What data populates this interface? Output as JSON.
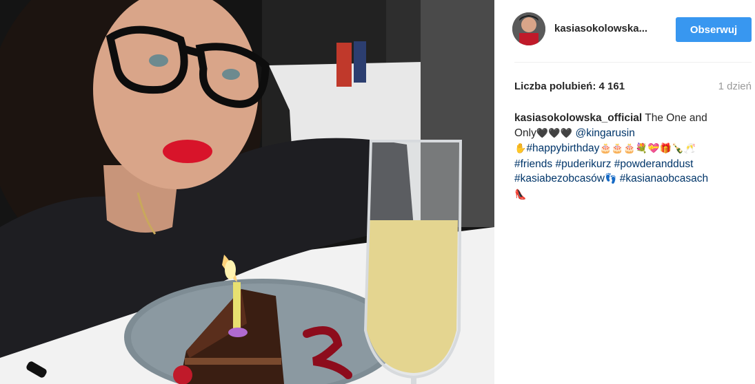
{
  "post": {
    "author": "kasiasokolowska...",
    "follow_label": "Obserwuj",
    "likes_label": "Liczba polubień: 4 161",
    "time": "1 dzień"
  },
  "caption": {
    "author": "kasiasokolowska_official",
    "text": " The One and",
    "text2": "Only",
    "hearts": "🖤🖤🖤",
    "mention": "@kingarusin",
    "hand_emoji": "✋",
    "hashtag1": "#happybirthday",
    "emojis1": "🎂🎂🎂💐💝🎁🍾🥂",
    "hashtag2": "#friends",
    "hashtag3": "#puderikurz",
    "hashtag4": "#powderanddust",
    "hashtag5": "#kasiabezobcasów",
    "feet_emoji": "👣",
    "hashtag6": "#kasianaobcasach",
    "shoe_emoji": "👠"
  },
  "colors": {
    "follow_button": "#3897f0",
    "link": "#003569",
    "muted": "#999999"
  }
}
